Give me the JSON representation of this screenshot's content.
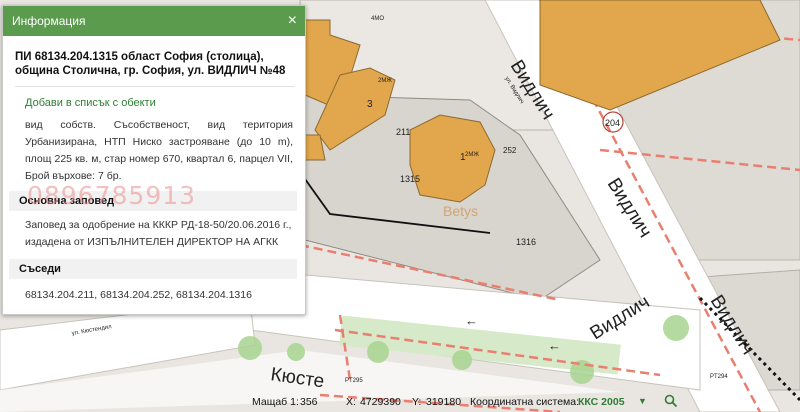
{
  "panel": {
    "header_title": "Информация",
    "close_symbol": "×",
    "parcel_title": "ПИ 68134.204.1315 област София (столица), община Столична, гр. София, ул. ВИДЛИЧ №48",
    "add_link": "Добави в списък с обекти",
    "description": "вид собств. Съсобственост, вид територия Урбанизирана, НТП Ниско застрояване (до 10 m), площ 225 кв. м, стар номер 670, квартал 6, парцел VII, Брой върхове: 7 бр.",
    "phone_overlay": "0896785913",
    "sections": {
      "order_heading": "Основна заповед",
      "order_text": "Заповед за одобрение на КККР РД-18-50/20.06.2016 г., издадена от ИЗПЪЛНИТЕЛЕН ДИРЕКТОР НА АГКК",
      "neighbors_heading": "Съседи",
      "neighbors_text": "68134.204.211, 68134.204.252, 68134.204.1316"
    }
  },
  "map": {
    "street_label": "Видлич",
    "street_label_partial": "Кюсте",
    "small_street_label": "ул. Кюстендил",
    "small_street_label_top": "ул. Видлич",
    "watermark": "Betys",
    "parcels": [
      "211",
      "1315",
      "1316",
      "252",
      "204"
    ],
    "buildings": [
      {
        "num": "1",
        "type": "2МЖ"
      },
      {
        "num": "3",
        "type": "2МЖ"
      },
      {
        "num": "",
        "type": "4МО"
      }
    ],
    "points": [
      "PT295",
      "PT294"
    ],
    "colors": {
      "building_fill": "#e2a74c",
      "building_stroke": "#8a6a30",
      "road": "#ffffff",
      "parcel_bg": "#d9d5cf",
      "red_line": "#e97f6f",
      "panel_header": "#5b9b4e"
    }
  },
  "status": {
    "scale_label": "Мащаб 1:",
    "scale_value": "356",
    "x_label": "X:",
    "x_value": "4729390",
    "y_label": "Y:",
    "y_value": "319180",
    "crs_label": "Координатна система:",
    "crs_value": "ККС 2005"
  }
}
